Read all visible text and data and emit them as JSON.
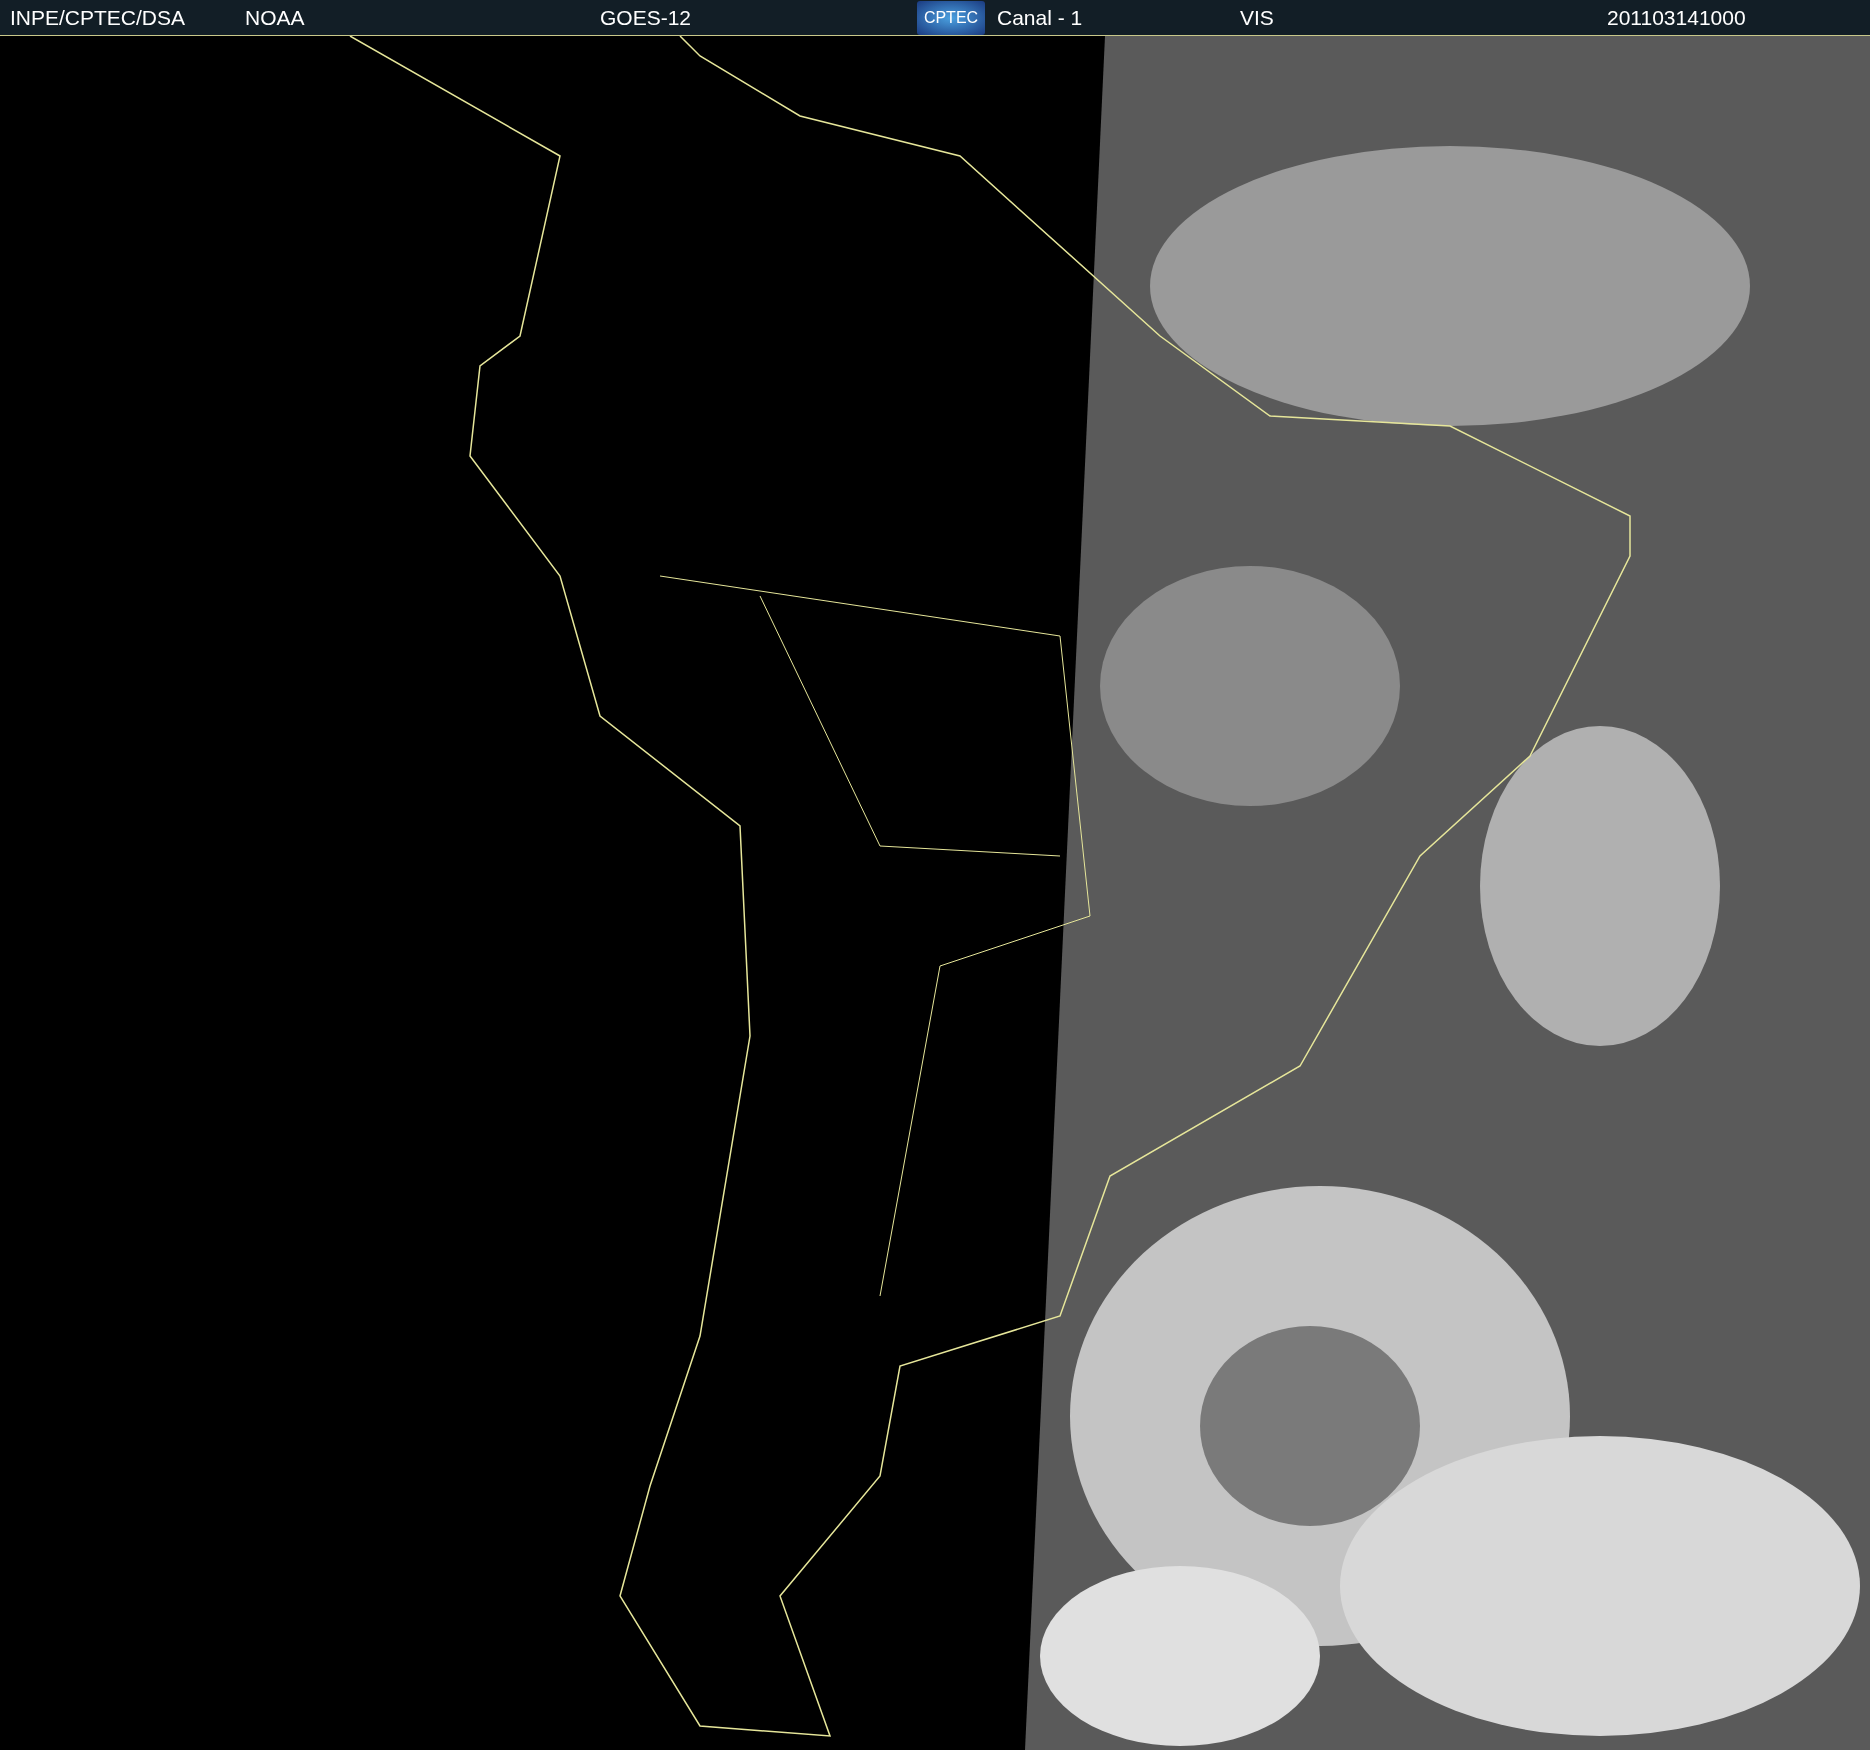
{
  "header": {
    "source": "INPE/CPTEC/DSA",
    "agency": "NOAA",
    "satellite": "GOES-12",
    "logo": "CPTEC",
    "channel": "Canal - 1",
    "band": "VIS",
    "timestamp": "201103141000"
  }
}
